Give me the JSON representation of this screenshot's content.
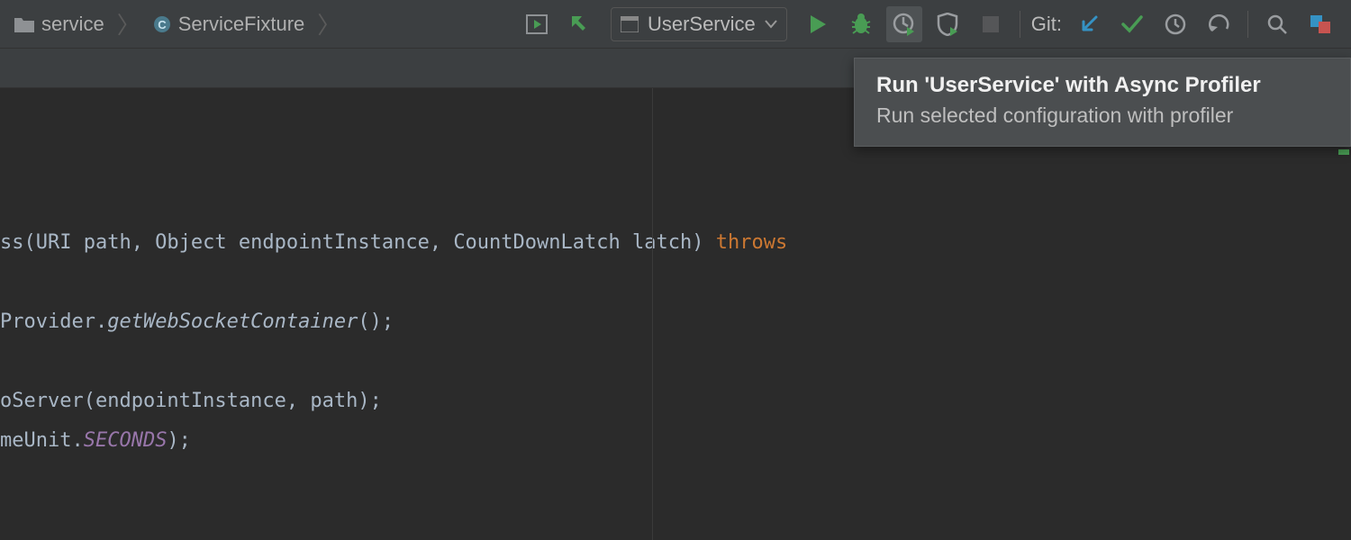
{
  "breadcrumb": {
    "item1": "service",
    "item2": "ServiceFixture"
  },
  "runConfig": {
    "selected": "UserService"
  },
  "git": {
    "label": "Git:"
  },
  "tooltip": {
    "title": "Run 'UserService' with Async Profiler",
    "desc": "Run selected configuration with profiler"
  },
  "code": {
    "l1a": "ss(URI path, Object endpointInstance, CountDownLatch latch) ",
    "l1b": "throws",
    "l2": "",
    "l3a": "Provider.",
    "l3b": "getWebSocketContainer",
    "l3c": "();",
    "l4": "",
    "l5": "oServer(endpointInstance, path);",
    "l6a": "meUnit.",
    "l6b": "SECONDS",
    "l6c": ");"
  }
}
